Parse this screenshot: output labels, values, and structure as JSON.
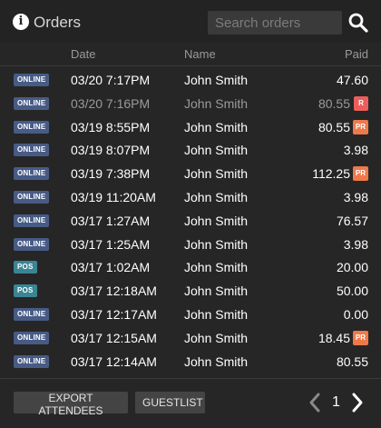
{
  "header": {
    "title": "Orders",
    "search_placeholder": "Search orders"
  },
  "columns": {
    "date": "Date",
    "name": "Name",
    "paid": "Paid"
  },
  "orders": [
    {
      "source": "ONLINE",
      "date": "03/20 7:17PM",
      "name": "John Smith",
      "paid": "47.60",
      "tag": "",
      "muted": false
    },
    {
      "source": "ONLINE",
      "date": "03/20 7:16PM",
      "name": "John Smith",
      "paid": "80.55",
      "tag": "R",
      "muted": true
    },
    {
      "source": "ONLINE",
      "date": "03/19 8:55PM",
      "name": "John Smith",
      "paid": "80.55",
      "tag": "PR",
      "muted": false
    },
    {
      "source": "ONLINE",
      "date": "03/19 8:07PM",
      "name": "John Smith",
      "paid": "3.98",
      "tag": "",
      "muted": false
    },
    {
      "source": "ONLINE",
      "date": "03/19 7:38PM",
      "name": "John Smith",
      "paid": "112.25",
      "tag": "PR",
      "muted": false
    },
    {
      "source": "ONLINE",
      "date": "03/19 11:20AM",
      "name": "John Smith",
      "paid": "3.98",
      "tag": "",
      "muted": false
    },
    {
      "source": "ONLINE",
      "date": "03/17 1:27AM",
      "name": "John Smith",
      "paid": "76.57",
      "tag": "",
      "muted": false
    },
    {
      "source": "ONLINE",
      "date": "03/17 1:25AM",
      "name": "John Smith",
      "paid": "3.98",
      "tag": "",
      "muted": false
    },
    {
      "source": "POS",
      "date": "03/17 1:02AM",
      "name": "John Smith",
      "paid": "20.00",
      "tag": "",
      "muted": false
    },
    {
      "source": "POS",
      "date": "03/17 12:18AM",
      "name": "John Smith",
      "paid": "50.00",
      "tag": "",
      "muted": false
    },
    {
      "source": "ONLINE",
      "date": "03/17 12:17AM",
      "name": "John Smith",
      "paid": "0.00",
      "tag": "",
      "muted": false
    },
    {
      "source": "ONLINE",
      "date": "03/17 12:15AM",
      "name": "John Smith",
      "paid": "18.45",
      "tag": "PR",
      "muted": false
    },
    {
      "source": "ONLINE",
      "date": "03/17 12:14AM",
      "name": "John Smith",
      "paid": "80.55",
      "tag": "",
      "muted": false
    }
  ],
  "footer": {
    "export_label": "EXPORT ATTENDEES",
    "guestlist_label": "GUESTLIST",
    "page": "1"
  },
  "colors": {
    "background": "#262626",
    "online_badge": "#475b85",
    "pos_badge": "#3a8594",
    "pr_tag": "#ee7a4b",
    "r_tag": "#ea5f5a"
  },
  "icons": [
    "info-icon",
    "search-icon",
    "chevron-left-icon",
    "chevron-right-icon"
  ]
}
